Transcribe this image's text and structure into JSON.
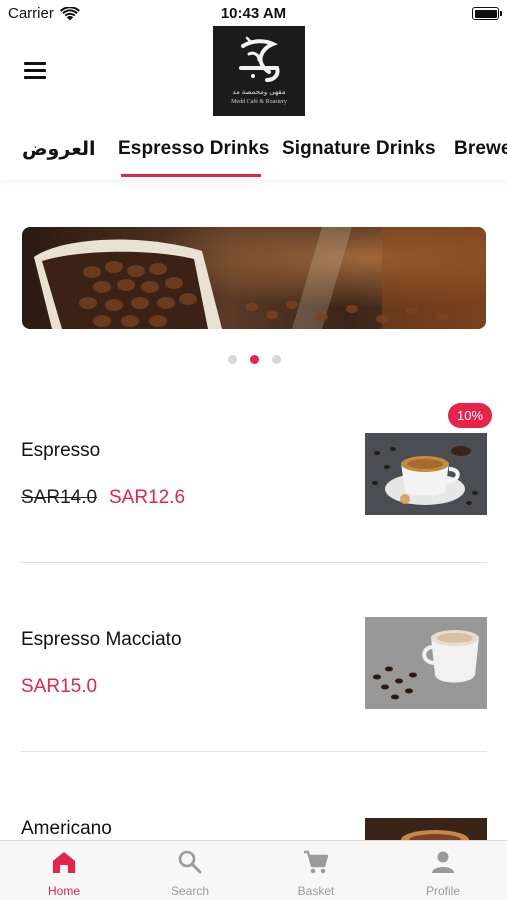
{
  "status_bar": {
    "carrier": "Carrier",
    "time": "10:43 AM"
  },
  "header": {
    "logo_text_ar": "مقهى ومحمصة مد",
    "logo_text_en": "Medd Café & Roastery"
  },
  "tabs": [
    {
      "label": "العروض"
    },
    {
      "label": "Espresso Drinks"
    },
    {
      "label": "Signature Drinks"
    },
    {
      "label": "Brewed"
    }
  ],
  "active_tab": "Espresso Drinks",
  "carousel": {
    "slide_count": 3,
    "active_index": 1
  },
  "products": [
    {
      "name": "Espresso",
      "old_price": "SAR14.0",
      "price": "SAR12.6",
      "badge": "10%"
    },
    {
      "name": "Espresso Macciato",
      "price": "SAR15.0"
    },
    {
      "name": "Americano"
    }
  ],
  "bottom_nav": [
    {
      "label": "Home",
      "icon": "home-icon",
      "active": true
    },
    {
      "label": "Search",
      "icon": "search-icon",
      "active": false
    },
    {
      "label": "Basket",
      "icon": "cart-icon",
      "active": false
    },
    {
      "label": "Profile",
      "icon": "person-icon",
      "active": false
    }
  ],
  "colors": {
    "accent": "#e8234a",
    "inactive": "#9a9a9a",
    "nav_bg": "#f7f7f7"
  }
}
